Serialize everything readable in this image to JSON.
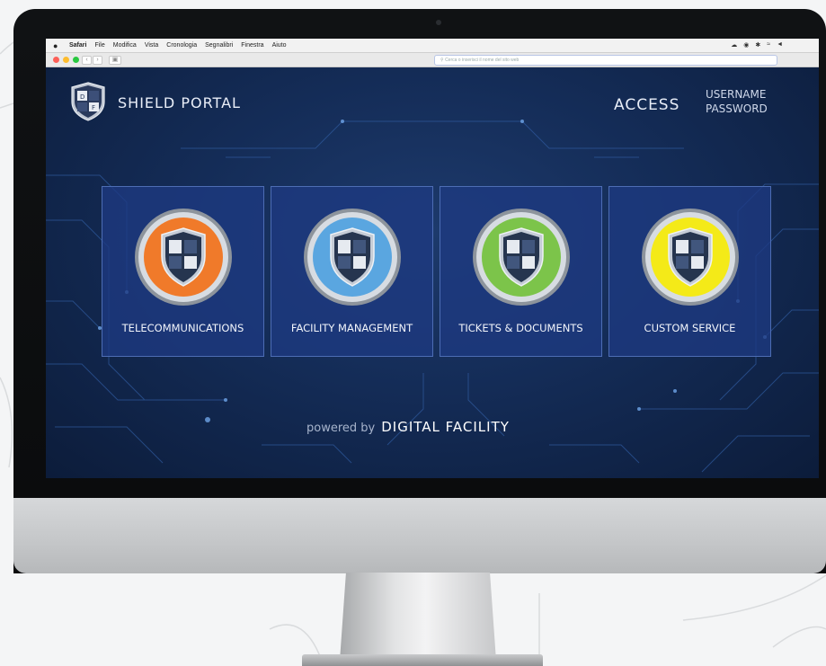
{
  "menubar": {
    "items": [
      "Safari",
      "File",
      "Modifica",
      "Vista",
      "Cronologia",
      "Segnalibri",
      "Finestra",
      "Aiuto"
    ]
  },
  "browser": {
    "address_placeholder": "Cerca o inserisci il nome del sito web"
  },
  "header": {
    "title": "SHIELD PORTAL",
    "access_label": "ACCESS",
    "username_label": "USERNAME",
    "password_label": "PASSWORD"
  },
  "tiles": [
    {
      "label": "TELECOMMUNICATIONS",
      "color": "#f07a2a"
    },
    {
      "label": "FACILITY MANAGEMENT",
      "color": "#5aa6e0"
    },
    {
      "label": "TICKETS & DOCUMENTS",
      "color": "#7cc44a"
    },
    {
      "label": "CUSTOM SERVICE",
      "color": "#f4ea18"
    }
  ],
  "footer": {
    "powered_label": "powered by",
    "brand": "DIGITAL FACILITY"
  },
  "colors": {
    "page_bg": "#142c57",
    "tile_bg": "#1e3a82",
    "tile_border": "#4d6db4"
  }
}
